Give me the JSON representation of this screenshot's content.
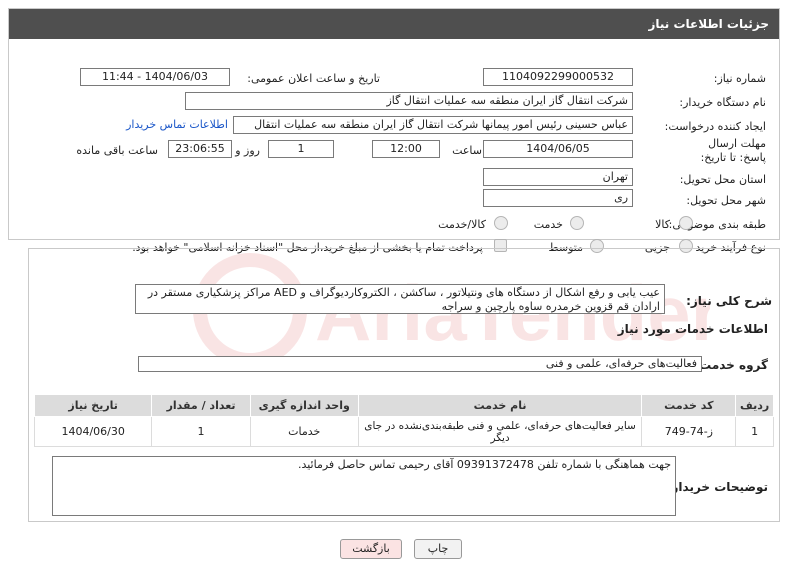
{
  "header": {
    "title": "جزئیات اطلاعات نیاز"
  },
  "fields": {
    "need_number_label": "شماره نیاز:",
    "need_number": "1104092299000532",
    "announce_label": "تاریخ و ساعت اعلان عمومی:",
    "announce_value": "1404/06/03 - 11:44",
    "buyer_label": "نام دستگاه خریدار:",
    "buyer_value": "شرکت انتقال گاز ایران منطقه سه عملیات انتقال گاز",
    "creator_label": "ایجاد کننده درخواست:",
    "creator_value": "عباس حسینی رئیس امور پیمانها شرکت انتقال گاز ایران منطقه سه عملیات انتقال",
    "contact_link": "اطلاعات تماس خریدار",
    "deadline_label": "مهلت ارسال پاسخ: تا تاریخ:",
    "deadline_date": "1404/06/05",
    "time_label": "ساعت",
    "deadline_time": "12:00",
    "days_value": "1",
    "days_label": "روز و",
    "remaining_time": "23:06:55",
    "remaining_label": "ساعت باقی مانده",
    "province_label": "استان محل تحویل:",
    "province_value": "تهران",
    "city_label": "شهر محل تحویل:",
    "city_value": "ری",
    "category_label": "طبقه بندی موضوعی:",
    "category_options": [
      "کالا",
      "خدمت",
      "کالا/خدمت"
    ],
    "process_label": "نوع فرآیند خرید :",
    "process_options": [
      "جزیی",
      "متوسط"
    ],
    "process_note": "پرداخت تمام یا بخشی از مبلغ خرید،از محل \"اسناد خزانه اسلامی\" خواهد بود."
  },
  "description": {
    "label": "شرح کلی نیاز:",
    "text": "عیب یابی و رفع اشکال از دستگاه های ونتیلاتور ، ساکشن ، الکتروکاردیوگراف و AED مراکز پزشکیاری مستقر در ارادان قم قزوین خرمدره ساوه پارچین و سراجه"
  },
  "services": {
    "section_title": "اطلاعات خدمات مورد نیاز",
    "group_label": "گروه خدمت:",
    "group_value": "فعالیت‌های حرفه‌ای، علمی و فنی",
    "columns": [
      "ردیف",
      "کد خدمت",
      "نام خدمت",
      "واحد اندازه گیری",
      "تعداد / مقدار",
      "تاریخ نیاز"
    ],
    "rows": [
      [
        "1",
        "ز-74-749",
        "سایر فعالیت‌های حرفه‌ای، علمی و فنی طبقه‌بندی‌نشده در جای دیگر",
        "خدمات",
        "1",
        "1404/06/30"
      ]
    ]
  },
  "buyer_notes": {
    "label": "توضیحات خریدار:",
    "text": "جهت هماهنگی با شماره تلفن 09391372478 آقای رحیمی تماس حاصل فرمائید."
  },
  "buttons": {
    "print": "چاپ",
    "back": "بازگشت"
  },
  "watermark": {
    "text": "AriaTender.neT"
  },
  "colors": {
    "header_bg": "#4f4f4f",
    "link": "#1a56c8",
    "back_btn": "#fbe3e3"
  }
}
